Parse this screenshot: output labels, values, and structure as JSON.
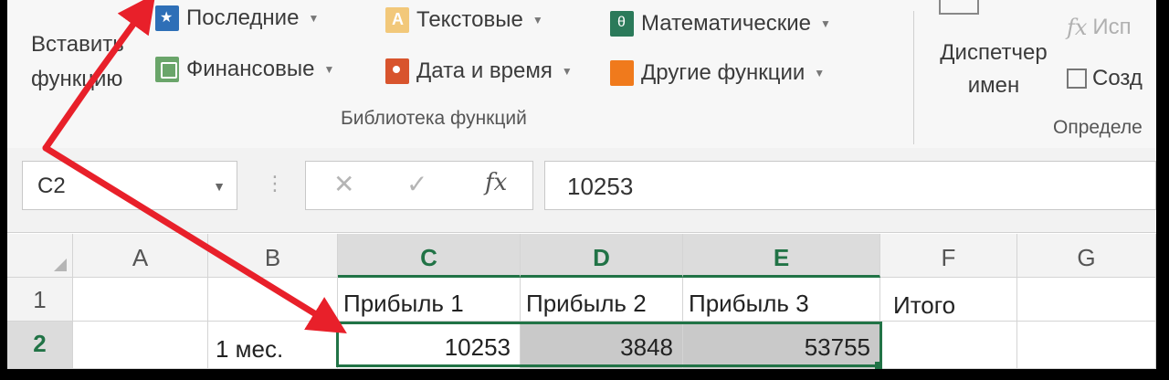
{
  "ribbon": {
    "insert_function": "Вставить функцию",
    "items": {
      "recent": "Последние",
      "text": "Текстовые",
      "math": "Математические",
      "financial": "Финансовые",
      "datetime": "Дата и время",
      "other": "Другие функции"
    },
    "library_label": "Библиотека функций",
    "name_manager": "Диспетчер имен",
    "use_in_formula": "Исп",
    "create": "Созд",
    "defined_names_label": "Определе"
  },
  "formula_bar": {
    "name_box": "C2",
    "cancel_icon": "✕",
    "enter_icon": "✓",
    "fx_icon": "fx",
    "value": "10253"
  },
  "grid": {
    "columns": [
      "A",
      "B",
      "C",
      "D",
      "E",
      "F",
      "G"
    ],
    "rows": [
      "1",
      "2"
    ],
    "row1": {
      "C": "Прибыль 1",
      "D": "Прибыль 2",
      "E": "Прибыль 3",
      "F": "Итого"
    },
    "row2": {
      "B": "1 мес.",
      "C": "10253",
      "D": "3848",
      "E": "53755"
    }
  },
  "colors": {
    "accent": "#217346",
    "annotation_arrow": "#e8202a"
  }
}
